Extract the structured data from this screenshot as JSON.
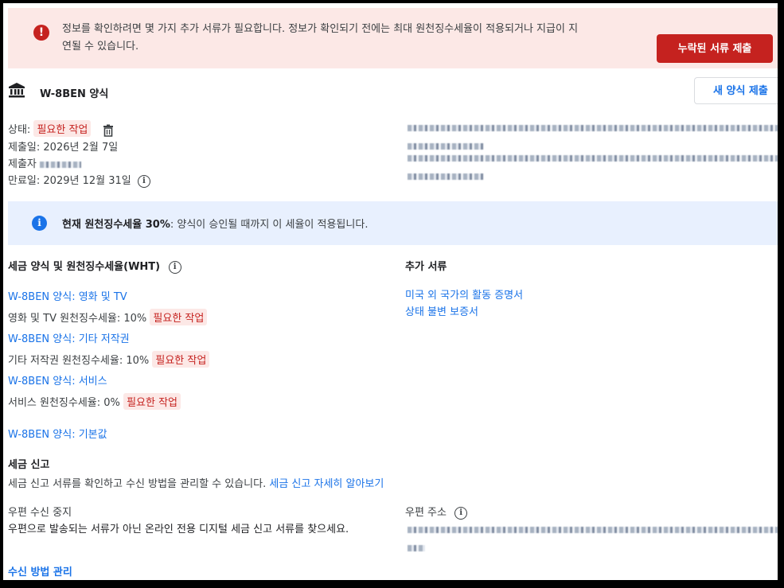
{
  "banner": {
    "message": "정보를 확인하려면 몇 가지 추가 서류가 필요합니다. 정보가 확인되기 전에는 최대 원천징수세율이 적용되거나 지급이 지연될 수 있습니다.",
    "message_line1": "정보를 확인하려면 몇 가지 추가 서류가 필요합니다. 정보가 확인되기 전에는 최대 원천징수세율이 적용되거나 지급이 지",
    "message_line2": "연될 수 있습니다.",
    "button": "누락된 서류 제출",
    "icon": "error-icon"
  },
  "form": {
    "title": "W-8BEN 양식",
    "new_form_button": "새 양식 제출",
    "status_label": "상태:",
    "status_value": "필요한 작업",
    "submitted_label": "제출일:",
    "submitted_value": "2026년 2월 7일",
    "submitter_label": "제출자",
    "expiry_label": "만료일:",
    "expiry_value": "2029년 12월 31일"
  },
  "info": {
    "bold": "현재 원천징수세율 30%",
    "rest": ": 양식이 승인될 때까지 이 세율이 적용됩니다."
  },
  "tax_forms": {
    "title": "세금 양식 및 원천징수세율(WHT)",
    "items": [
      {
        "link": "W-8BEN 양식: 영화 및 TV",
        "rate": "영화 및 TV 원천징수세율: 10%",
        "badge": "필요한 작업"
      },
      {
        "link": "W-8BEN 양식: 기타 저작권",
        "rate": "기타 저작권 원천징수세율: 10%",
        "badge": "필요한 작업"
      },
      {
        "link": "W-8BEN 양식: 서비스",
        "rate": "서비스 원천징수세율: 0%",
        "badge": "필요한 작업"
      }
    ],
    "default_link": "W-8BEN 양식: 기본값"
  },
  "extra_docs": {
    "title": "추가 서류",
    "links": [
      "미국 외 국가의 활동 증명서",
      "상태 불변 보증서"
    ]
  },
  "tax_reports": {
    "title": "세금 신고",
    "desc": "세금 신고 서류를 확인하고 수신 방법을 관리할 수 있습니다.",
    "learn_more": "세금 신고 자세히 알아보기",
    "paper_stop_title": "우편 수신 중지",
    "paper_stop_desc": "우편으로 발송되는 서류가 아닌 온라인 전용 디지털 세금 신고 서류를 찾으세요.",
    "mail_address_label": "우편 주소",
    "manage_link": "수신 방법 관리"
  },
  "colors": {
    "error": "#c5221f",
    "error_bg": "#fce8e6",
    "link": "#1a73e8",
    "info_bg": "#e8f0fe"
  }
}
